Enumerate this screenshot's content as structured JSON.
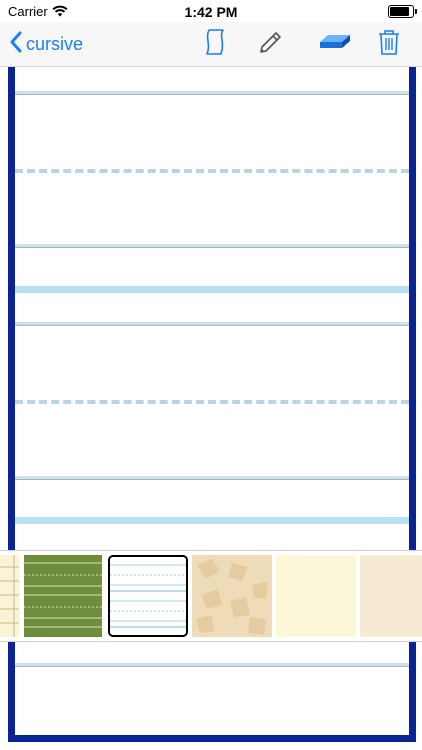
{
  "status_bar": {
    "carrier": "Carrier",
    "time": "1:42 PM",
    "battery_level": 1.0
  },
  "nav": {
    "back_label": "cursive",
    "tools": [
      "paper-style-icon",
      "pencil-icon",
      "eraser-icon",
      "trash-icon"
    ]
  },
  "colors": {
    "accent": "#1a7ff6",
    "paper_border": "#0b2494",
    "guide_line": "#b7e1f2"
  },
  "paper_styles": [
    {
      "name": "yellow-grid-paper"
    },
    {
      "name": "green-chalkboard-paper"
    },
    {
      "name": "blue-lined-paper",
      "selected": true
    },
    {
      "name": "parchment-paper"
    },
    {
      "name": "cream-paper"
    },
    {
      "name": "beige-paper"
    }
  ]
}
